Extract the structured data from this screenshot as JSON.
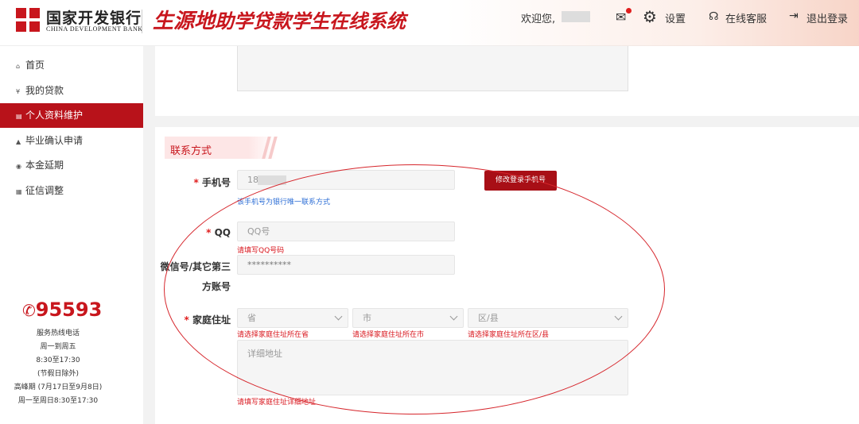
{
  "header": {
    "bank_name_cn": "国家开发银行",
    "bank_name_en": "CHINA DEVELOPMENT BANK",
    "system_title_a": "生源地",
    "system_title_b": "助学贷款学生在线系统",
    "welcome": "欢迎您,",
    "settings": "设置",
    "online_service": "在线客服",
    "logout": "退出登录"
  },
  "sidebar": {
    "items": [
      {
        "label": "首页",
        "icon": "home-icon",
        "glyph": "⌂"
      },
      {
        "label": "我的贷款",
        "icon": "loan-icon",
        "glyph": "¥"
      },
      {
        "label": "个人资料维护",
        "icon": "profile-icon",
        "glyph": "▤"
      },
      {
        "label": "毕业确认申请",
        "icon": "graduate-icon",
        "glyph": "▲"
      },
      {
        "label": "本金延期",
        "icon": "clock-icon",
        "glyph": "◉"
      },
      {
        "label": "征信调整",
        "icon": "credit-icon",
        "glyph": "▦"
      }
    ],
    "active_index": 2,
    "hotline": "95593",
    "hotline_label": "服务热线电话",
    "hours": [
      "周一到周五",
      "8:30至17:30",
      "(节假日除外)",
      "高峰期 (7月17日至9月8日)",
      "周一至周日8:30至17:30"
    ]
  },
  "form": {
    "section_title": "联系方式",
    "phone_label": "手机号",
    "phone_value": "18",
    "phone_hint": "该手机号为银行唯一联系方式",
    "change_phone_button": "修改登录手机号",
    "qq_label": "QQ",
    "qq_placeholder": "QQ号",
    "qq_error": "请填写QQ号码",
    "wechat_label_line1": "微信号/其它第三",
    "wechat_label_line2": "方账号",
    "wechat_value": "**********",
    "address_label": "家庭住址",
    "province_placeholder": "省",
    "city_placeholder": "市",
    "district_placeholder": "区/县",
    "province_error": "请选择家庭住址所在省",
    "city_error": "请选择家庭住址所在市",
    "district_error": "请选择家庭住址所在区/县",
    "detail_placeholder": "详细地址",
    "detail_error": "请填写家庭住址详细地址"
  },
  "colors": {
    "brand_red": "#c8161d",
    "active_nav": "#b8121a",
    "hint_blue": "#2e6fd6"
  }
}
